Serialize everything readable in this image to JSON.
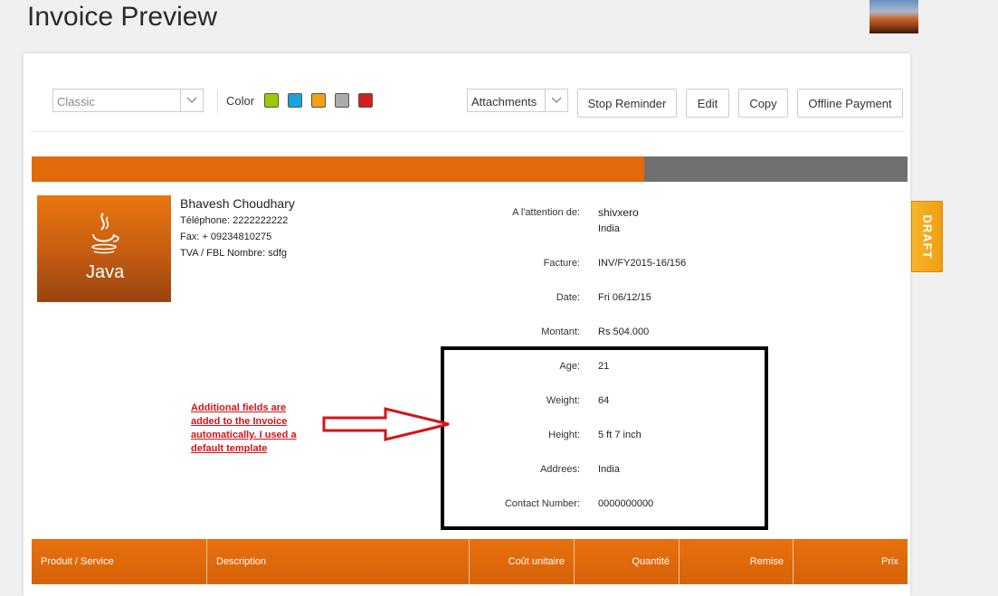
{
  "page": {
    "title": "Invoice Preview"
  },
  "toolbar": {
    "template_value": "Classic",
    "color_label": "Color",
    "swatches": [
      "#99cc00",
      "#1aa3dc",
      "#f5a00f",
      "#a6adab",
      "#d41d1d"
    ],
    "attachments_value": "Attachments",
    "stop_reminder_label": "Stop Reminder",
    "edit_label": "Edit",
    "copy_label": "Copy",
    "offline_payment_label": "Offline Payment"
  },
  "company": {
    "logo_text": "Java",
    "name": "Bhavesh Choudhary",
    "phone": "Téléphone: 2222222222",
    "fax": "Fax: + 09234810275",
    "tax": "TVA / FBL Nombre: sdfg"
  },
  "fields": {
    "attention_label": "A l'attention de:",
    "attention_value": "shivxero",
    "attention_country": "India",
    "invoice_label": "Facture:",
    "invoice_value": "INV/FY2015-16/156",
    "date_label": "Date:",
    "date_value": "Fri 06/12/15",
    "amount_label": "Montant:",
    "amount_value": "Rs 504.000",
    "age_label": "Age:",
    "age_value": "21",
    "weight_label": "Weight:",
    "weight_value": "64",
    "height_label": "Height:",
    "height_value": "5 ft 7 inch",
    "address_label": "Addrees:",
    "address_value": "India",
    "contact_label": "Contact Number:",
    "contact_value": "0000000000"
  },
  "annotation": {
    "note": "Additional fields are added to the Invoice automatically. I used a default template"
  },
  "table": {
    "columns": [
      "Produit / Service",
      "Description",
      "Coût unitaire",
      "Quantité",
      "Remise",
      "Prix"
    ]
  },
  "status": {
    "draft_label": "DRAFT"
  },
  "colors": {
    "accent": "#e16a0a",
    "draft": "#f5a81b",
    "note": "#d4141a"
  }
}
